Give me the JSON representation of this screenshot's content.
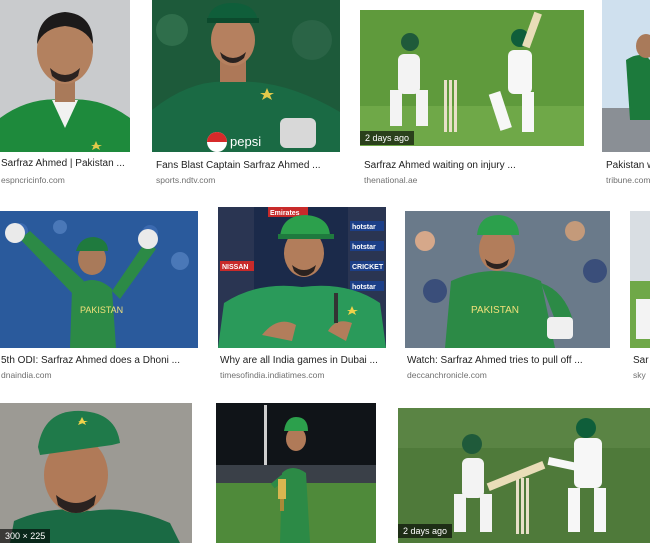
{
  "results": [
    {
      "title": "Sarfraz Ahmed | Pakistan ...",
      "source": "espncricinfo.com",
      "badge": ""
    },
    {
      "title": "Fans Blast Captain Sarfraz Ahmed ...",
      "source": "sports.ndtv.com",
      "badge": ""
    },
    {
      "title": "Sarfraz Ahmed waiting on injury ...",
      "source": "thenational.ae",
      "badge": "2 days ago"
    },
    {
      "title": "Pakistan w",
      "source": "tribune.com",
      "badge": ""
    },
    {
      "title": "5th ODI: Sarfraz Ahmed does a Dhoni ...",
      "source": "dnaindia.com",
      "badge": ""
    },
    {
      "title": "Why are all India games in Dubai ...",
      "source": "timesofindia.indiatimes.com",
      "badge": ""
    },
    {
      "title": "Watch: Sarfraz Ahmed tries to pull off ...",
      "source": "deccanchronicle.com",
      "badge": ""
    },
    {
      "title": "Sar",
      "source": "sky",
      "badge": ""
    },
    {
      "title": "",
      "source": "",
      "badge": "300 × 225"
    },
    {
      "title": "",
      "source": "",
      "badge": ""
    },
    {
      "title": "",
      "source": "",
      "badge": "2 days ago"
    }
  ],
  "image_texts": {
    "pepsi": "pepsi",
    "sponsor_board": [
      "Emirates",
      "hotstar",
      "NISSAN",
      "hotstar",
      "CRICKET",
      "hotstar"
    ],
    "jersey": "PAKISTAN"
  },
  "colors": {
    "pakistan_green": "#1f7a3e",
    "pitch_green": "#5f9a3c",
    "stand_blue": "#2a5a9c"
  }
}
